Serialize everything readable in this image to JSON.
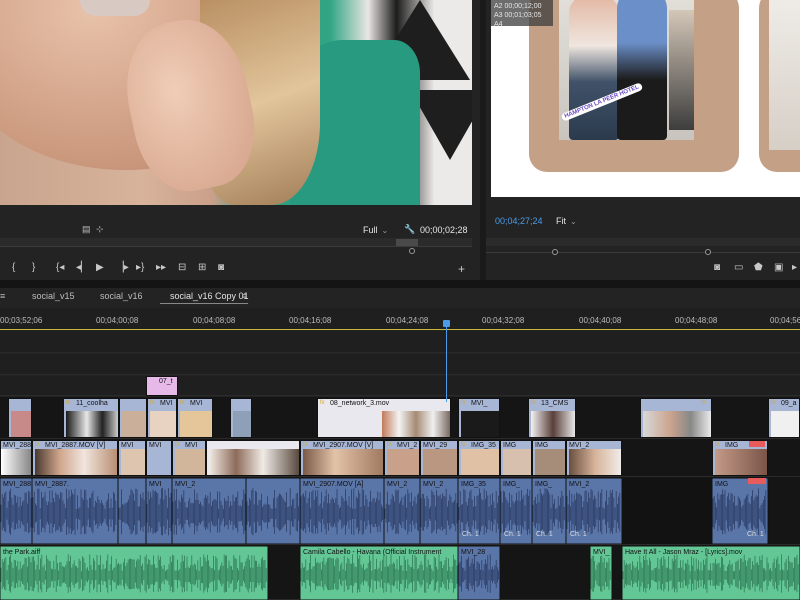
{
  "source_monitor": {
    "timecode_left": "",
    "fit_label": "Full",
    "timecode_right": "00;00;02;28"
  },
  "program_monitor": {
    "overlay_lines": [
      "A2 00;00;12;00",
      "A3 00;01;03;05",
      "A4"
    ],
    "photo_tag": "HAMPTON LA PEER HOTEL",
    "timecode": "00;04;27;24",
    "fit_label": "Fit"
  },
  "timeline": {
    "tabs": [
      "social_v15",
      "social_v16",
      "social_v16 Copy 01"
    ],
    "active_tab_index": 2,
    "ruler_ticks": [
      "00;03;52;06",
      "00;04;00;08",
      "00;04;08;08",
      "00;04;16;08",
      "00;04;24;08",
      "00;04;32;08",
      "00;04;40;08",
      "00;04;48;08",
      "00;04;56"
    ],
    "v3_clips": [
      "07_t"
    ],
    "v2_clips": [
      "11_coolha",
      "MVI",
      "MVI",
      "08_network_3.mov",
      "MVI_",
      "13_CMS",
      "09_a"
    ],
    "v1_clips": [
      "MVI_288",
      "MVI_2887.MOV [V]",
      "MVI",
      "MVI",
      "MVI",
      "MVI_2907.MOV [V]",
      "MVI_2",
      "MVI_29",
      "IMG_35",
      "IMG",
      "IMG",
      "MVI_2",
      "IMG"
    ],
    "a1_clips": [
      "MVI_288",
      "MVI_2887.",
      "MVI",
      "MVI_2",
      "MVI_2907.MOV [A]",
      "MVI_2",
      "MVI_2",
      "IMG_35",
      "IMG_",
      "IMG_",
      "MVI_2",
      "IMG"
    ],
    "a2_clips": [
      "the Park.aiff",
      "Camila Cabello - Havana (Official Instrument",
      "MVI_28",
      "MVI_",
      "Have It All - Jason Mraz - [Lyrics].mov"
    ],
    "channel_labels": [
      "Ch. 1",
      "Ch. 1",
      "Ch. 1",
      "Ch. 1",
      "Ch. 1"
    ]
  },
  "icons": [
    "marker-icon",
    "export-frame-icon",
    "camera-icon",
    "add-button-icon",
    "wrench-icon"
  ],
  "colors": {
    "timecode_blue": "#4b9ce8",
    "video_clip": "#a8b6d6",
    "audio_clip": "#5a75a8",
    "music_clip": "#63c795",
    "title_clip": "#e7b9e8"
  }
}
